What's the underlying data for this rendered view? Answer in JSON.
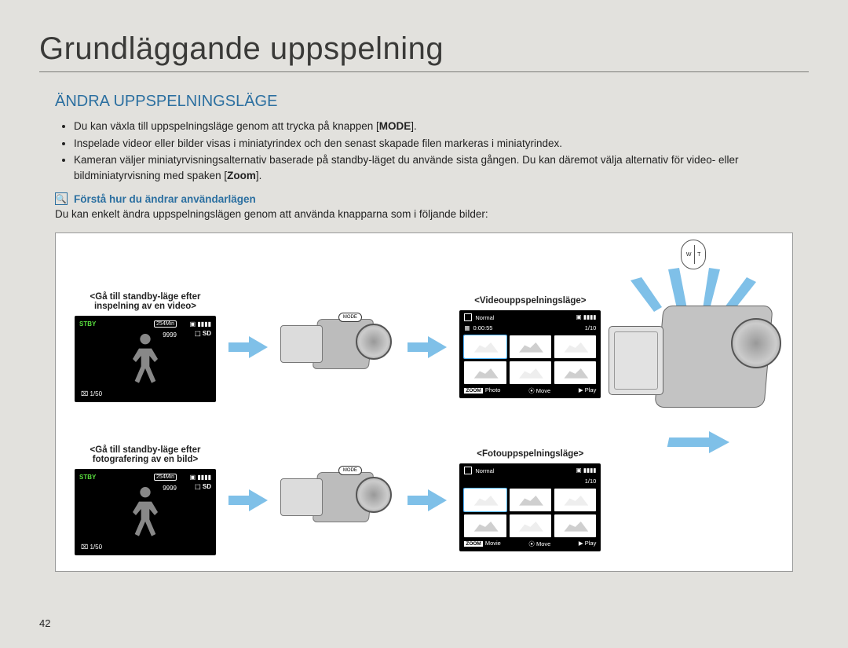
{
  "page_number": "42",
  "title": "Grundläggande uppspelning",
  "section_title": "ÄNDRA UPPSPELNINGSLÄGE",
  "bullets": [
    {
      "prefix": "Du kan växla till uppspelningsläge genom att trycka på knappen [",
      "bold": "MODE",
      "suffix": "]."
    },
    {
      "full": "Inspelade videor eller bilder visas i miniatyrindex och den senast skapade filen markeras i miniatyrindex."
    },
    {
      "prefix": "Kameran väljer miniatyrvisningsalternativ baserade på standby-läget du använde sista gången. Du kan däremot välja alternativ för video- eller bildminiatyrvisning med spaken [",
      "bold": "Zoom",
      "suffix": "]."
    }
  ],
  "hint": {
    "icon": "🔍",
    "title": "Förstå hur du ändrar användarlägen",
    "text": "Du kan enkelt ändra uppspelningslägen genom att använda knapparna som i följande bilder:"
  },
  "figure": {
    "video_standby_caption": "<Gå till standby-läge efter inspelning av en video>",
    "photo_standby_caption": "<Gå till standby-läge efter fotografering av en bild>",
    "video_playback_caption": "<Videouppspelningsläge>",
    "photo_playback_caption": "<Fotouppspelningsläge>",
    "lcd": {
      "status": "STBY",
      "minutes": "254Min",
      "battery_icons": "▣ ▮▮▮▮",
      "count": "9999",
      "sd": "⬚ SD",
      "bottom_left": "⌧ 1/50"
    },
    "mode_label": "MODE",
    "playback_video": {
      "top_mode": "Normal",
      "battery": "▣ ▮▮▮▮",
      "duration": "0:00:55",
      "fraction": "1/10",
      "duration_icon": "▦",
      "bottom": {
        "zoom": "ZOOM",
        "left": "Photo",
        "mid_icon": "⦿",
        "mid": "Move",
        "right_icon": "▶",
        "right": "Play"
      }
    },
    "playback_photo": {
      "top_mode": "Normal",
      "battery": "▣ ▮▮▮▮",
      "fraction": "1/10",
      "bottom": {
        "zoom": "ZOOM",
        "left": "Movie",
        "mid_icon": "⦿",
        "mid": "Move",
        "right_icon": "▶",
        "right": "Play"
      }
    },
    "zoom_toggle": {
      "w": "W",
      "t": "T"
    }
  }
}
